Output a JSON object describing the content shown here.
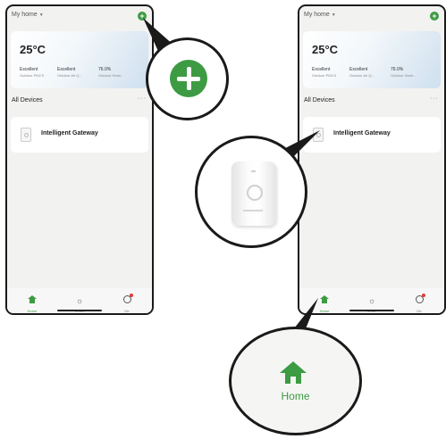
{
  "screens": [
    {
      "home_title": "My home",
      "weather": {
        "temperature": "25°C",
        "stats": [
          {
            "value": "Excellent",
            "label": "Outdoor PM2.5"
          },
          {
            "value": "Excellent",
            "label": "Outdoor Air Q..."
          },
          {
            "value": "76.0%",
            "label": "Outdoor Humi..."
          }
        ]
      },
      "section_title": "All Devices",
      "more": "···",
      "device": {
        "name": "Intelligent Gateway"
      },
      "tabs": [
        {
          "label": "Home",
          "icon": "home-icon"
        },
        {
          "label": "Smart",
          "icon": "sun-icon"
        },
        {
          "label": "Me",
          "icon": "profile-icon"
        }
      ]
    },
    {
      "home_title": "My home",
      "weather": {
        "temperature": "25°C",
        "stats": [
          {
            "value": "Excellent",
            "label": "Outdoor PM2.5"
          },
          {
            "value": "Excellent",
            "label": "Outdoor Air Q..."
          },
          {
            "value": "76.0%",
            "label": "Outdoor Humi..."
          }
        ]
      },
      "section_title": "All Devices",
      "more": "···",
      "device": {
        "name": "Intelligent Gateway"
      },
      "tabs": [
        {
          "label": "Home",
          "icon": "home-icon"
        },
        {
          "label": "Smart",
          "icon": "sun-icon"
        },
        {
          "label": "Me",
          "icon": "profile-icon"
        }
      ]
    }
  ],
  "zoom_home_label": "Home",
  "colors": {
    "accent": "#3d9b43",
    "badge": "#e53935"
  }
}
